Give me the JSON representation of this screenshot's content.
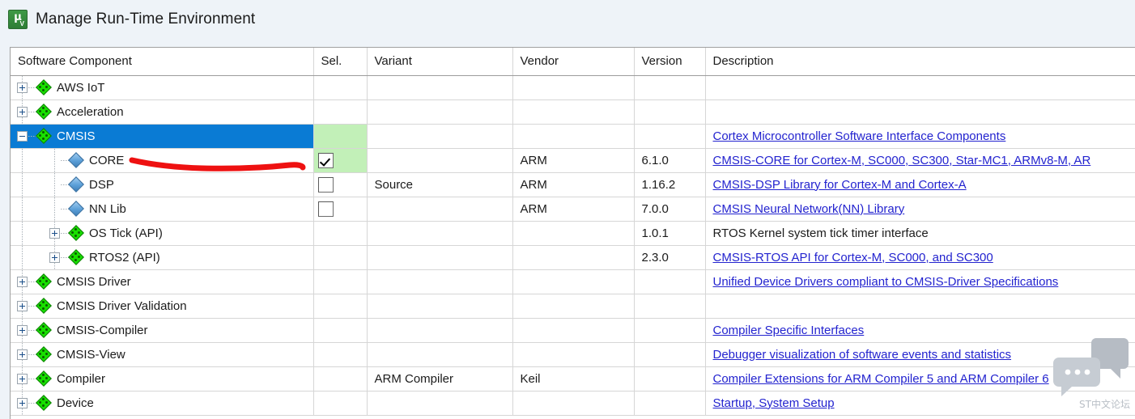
{
  "window": {
    "title": "Manage Run-Time Environment",
    "icon": "keil-uvision-icon",
    "icon_glyph_main": "µ",
    "icon_glyph_sub": "V"
  },
  "table": {
    "columns": [
      {
        "key": "name",
        "label": "Software Component"
      },
      {
        "key": "sel",
        "label": "Sel."
      },
      {
        "key": "variant",
        "label": "Variant"
      },
      {
        "key": "vendor",
        "label": "Vendor"
      },
      {
        "key": "version",
        "label": "Version"
      },
      {
        "key": "desc",
        "label": "Description"
      }
    ],
    "rows": [
      {
        "name": "AWS IoT",
        "depth": 0,
        "icon": "green-diamond-icon",
        "expander": "plus",
        "selected": false,
        "sel_state": "none",
        "sel_bg": "white",
        "variant": "",
        "vendor": "",
        "version": "",
        "desc": "",
        "desc_is_link": false
      },
      {
        "name": "Acceleration",
        "depth": 0,
        "icon": "green-diamond-icon",
        "expander": "plus",
        "selected": false,
        "sel_state": "none",
        "sel_bg": "white",
        "variant": "",
        "vendor": "",
        "version": "",
        "desc": "",
        "desc_is_link": false
      },
      {
        "name": "CMSIS",
        "depth": 0,
        "icon": "green-diamond-icon",
        "expander": "minus",
        "selected": true,
        "sel_state": "none",
        "sel_bg": "green",
        "variant": "",
        "vendor": "",
        "version": "",
        "desc": "Cortex Microcontroller Software Interface Components",
        "desc_is_link": true
      },
      {
        "name": "CORE",
        "depth": 1,
        "icon": "blue-diamond-icon",
        "expander": "none",
        "selected": false,
        "sel_state": "checked",
        "sel_bg": "green",
        "variant": "",
        "vendor": "ARM",
        "version": "6.1.0",
        "desc": "CMSIS-CORE for Cortex-M, SC000, SC300, Star-MC1, ARMv8-M, AR",
        "desc_is_link": true
      },
      {
        "name": "DSP",
        "depth": 1,
        "icon": "blue-diamond-icon",
        "expander": "none",
        "selected": false,
        "sel_state": "unchecked",
        "sel_bg": "white",
        "variant": "Source",
        "vendor": "ARM",
        "version": "1.16.2",
        "desc": "CMSIS-DSP Library for Cortex-M and Cortex-A",
        "desc_is_link": true
      },
      {
        "name": "NN Lib",
        "depth": 1,
        "icon": "blue-diamond-icon",
        "expander": "none",
        "selected": false,
        "sel_state": "unchecked",
        "sel_bg": "white",
        "variant": "",
        "vendor": "ARM",
        "version": "7.0.0",
        "desc": "CMSIS Neural Network(NN) Library",
        "desc_is_link": true
      },
      {
        "name": "OS Tick (API)",
        "depth": 1,
        "icon": "green-diamond-icon",
        "expander": "plus",
        "selected": false,
        "sel_state": "none",
        "sel_bg": "white",
        "variant": "",
        "vendor": "",
        "version": "1.0.1",
        "desc": "RTOS Kernel system tick timer interface",
        "desc_is_link": false
      },
      {
        "name": "RTOS2 (API)",
        "depth": 1,
        "icon": "green-diamond-icon",
        "expander": "plus",
        "selected": false,
        "sel_state": "none",
        "sel_bg": "white",
        "variant": "",
        "vendor": "",
        "version": "2.3.0",
        "desc": "CMSIS-RTOS API for Cortex-M, SC000, and SC300",
        "desc_is_link": true
      },
      {
        "name": "CMSIS Driver",
        "depth": 0,
        "icon": "green-diamond-icon",
        "expander": "plus",
        "selected": false,
        "sel_state": "none",
        "sel_bg": "white",
        "variant": "",
        "vendor": "",
        "version": "",
        "desc": "Unified Device Drivers compliant to CMSIS-Driver Specifications",
        "desc_is_link": true
      },
      {
        "name": "CMSIS Driver Validation",
        "depth": 0,
        "icon": "green-diamond-icon",
        "expander": "plus",
        "selected": false,
        "sel_state": "none",
        "sel_bg": "white",
        "variant": "",
        "vendor": "",
        "version": "",
        "desc": "",
        "desc_is_link": false
      },
      {
        "name": "CMSIS-Compiler",
        "depth": 0,
        "icon": "green-diamond-icon",
        "expander": "plus",
        "selected": false,
        "sel_state": "none",
        "sel_bg": "white",
        "variant": "",
        "vendor": "",
        "version": "",
        "desc": "Compiler Specific Interfaces",
        "desc_is_link": true
      },
      {
        "name": "CMSIS-View",
        "depth": 0,
        "icon": "green-diamond-icon",
        "expander": "plus",
        "selected": false,
        "sel_state": "none",
        "sel_bg": "white",
        "variant": "",
        "vendor": "",
        "version": "",
        "desc": "Debugger visualization of software events and statistics",
        "desc_is_link": true
      },
      {
        "name": "Compiler",
        "depth": 0,
        "icon": "green-diamond-icon",
        "expander": "plus",
        "selected": false,
        "sel_state": "none",
        "sel_bg": "white",
        "variant": "ARM Compiler",
        "vendor": "Keil",
        "version": "",
        "desc": "Compiler Extensions for ARM Compiler 5 and ARM Compiler 6",
        "desc_is_link": true
      },
      {
        "name": "Device",
        "depth": 0,
        "icon": "green-diamond-icon",
        "expander": "plus",
        "selected": false,
        "sel_state": "none",
        "sel_bg": "white",
        "variant": "",
        "vendor": "",
        "version": "",
        "desc": "Startup, System Setup",
        "desc_is_link": true
      }
    ]
  },
  "annotation": {
    "type": "freehand-line",
    "color": "#ee1111"
  },
  "watermark": {
    "text": "ST中文论坛",
    "icon": "chat-bubbles-icon",
    "color": "#b9bfc6"
  },
  "colors": {
    "selection_blue": "#0a7bd4",
    "sel_green": "#c2f0b8",
    "link_blue": "#2323cf",
    "dialog_bg": "#eef3f8",
    "grid_line": "#d6d6d6"
  }
}
